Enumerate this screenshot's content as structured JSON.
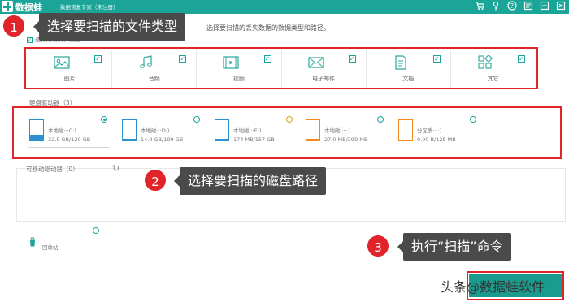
{
  "titlebar": {
    "app_name": "数据蛙",
    "app_sub": "数据恢复专家（未注册）",
    "icons": [
      "cart-icon",
      "key-icon",
      "help-icon",
      "feedback-icon",
      "minimize-icon",
      "close-icon"
    ]
  },
  "header": {
    "subtitle": "选择要扫描的丢失数据的数据类型和路径。",
    "select_all_label": "选择所有文件类型"
  },
  "file_types": [
    {
      "label": "图片",
      "icon": "image-icon",
      "checked": true
    },
    {
      "label": "音频",
      "icon": "audio-icon",
      "checked": true
    },
    {
      "label": "视频",
      "icon": "video-icon",
      "checked": true
    },
    {
      "label": "电子邮件",
      "icon": "email-icon",
      "checked": true
    },
    {
      "label": "文档",
      "icon": "document-icon",
      "checked": true
    },
    {
      "label": "其它",
      "icon": "other-icon",
      "checked": true
    }
  ],
  "drives_section": {
    "label": "硬盘驱动器（5）",
    "drives": [
      {
        "name": "本地磁···C:)",
        "size": "32.9 GB/120 GB",
        "selected": true,
        "color": "#2e8fd0",
        "usage": 0.27
      },
      {
        "name": "本地磁···D:)",
        "size": "14.9 GB/199 GB",
        "selected": false,
        "color": "#2e8fd0",
        "usage": 0.07
      },
      {
        "name": "本地磁···E:)",
        "size": "174 MB/157 GB",
        "selected": false,
        "color": "#2e8fd0",
        "usage": 0.01
      },
      {
        "name": "本地磁····:)",
        "size": "27.0 MB/299 MB",
        "selected": false,
        "color": "#f08a1d",
        "usage": 0.09
      },
      {
        "name": "分区丢···:)",
        "size": "0.00  B/128 MB",
        "selected": false,
        "color": "#f08a1d",
        "usage": 0.0
      }
    ]
  },
  "removable_section": {
    "label": "可移动驱动器（0）"
  },
  "recycle_bin": {
    "label": "回收站"
  },
  "annotations": [
    {
      "number": "1",
      "text": "选择要扫描的文件类型"
    },
    {
      "number": "2",
      "text": "选择要扫描的磁盘路径"
    },
    {
      "number": "3",
      "text": "执行“扫描”命令"
    }
  ],
  "watermark": "头条@数据蛙软件",
  "colors": {
    "accent": "#1aa598",
    "annotation_red": "#e0242a",
    "callout_bg": "#4a4a4a"
  }
}
